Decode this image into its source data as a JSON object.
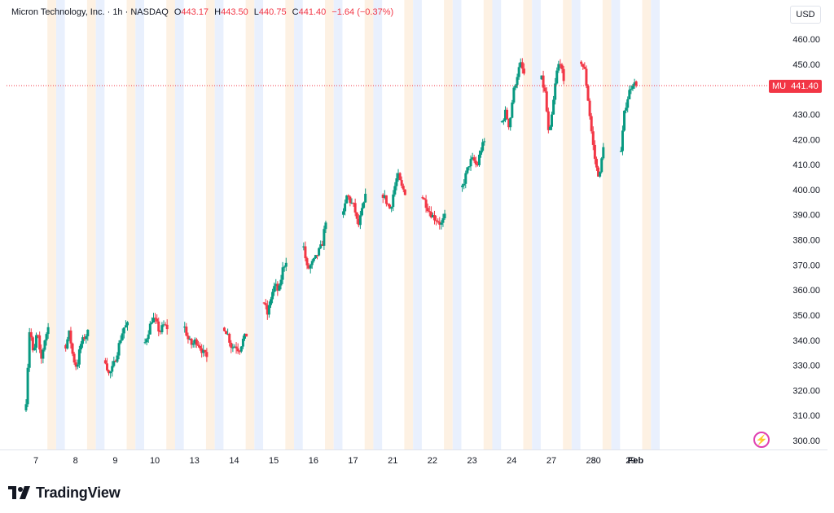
{
  "legend": {
    "symbol": "Micron Technology, Inc. · 1h · NASDAQ",
    "open_key": "O",
    "open": "443.17",
    "high_key": "H",
    "high": "443.50",
    "low_key": "L",
    "low": "440.75",
    "close_key": "C",
    "close": "441.40",
    "change": "−1.64 (−0.37%)"
  },
  "currency": "USD",
  "last_price": {
    "symbol": "MU",
    "value": "441.40",
    "price": 441.4
  },
  "branding": {
    "name": "TradingView"
  },
  "colors": {
    "up": "#089981",
    "down": "#f23645",
    "day_band_a": "#e9f0fd",
    "day_band_b": "#fdf1e3",
    "text": "#131722"
  },
  "icons": {
    "logo": "tradingview-logo-icon",
    "lightning": "lightning-icon"
  },
  "chart_data": {
    "type": "candlestick",
    "interval": "1h",
    "y_axis": {
      "ticks": [
        300,
        310,
        320,
        330,
        340,
        350,
        360,
        370,
        380,
        390,
        400,
        410,
        420,
        430,
        440,
        450,
        460
      ],
      "ylim": [
        297,
        462
      ],
      "position": "right"
    },
    "x_axis": {
      "labels": [
        "7",
        "8",
        "9",
        "10",
        "13",
        "14",
        "15",
        "16",
        "17",
        "21",
        "22",
        "23",
        "24",
        "27",
        "28",
        "29",
        "30",
        "Feb"
      ]
    },
    "session_anchors": [
      [
        316,
        346,
        333,
        344,
        331,
        340,
        345
      ],
      [
        338,
        343,
        333,
        329,
        338,
        341,
        343
      ],
      [
        332,
        326,
        329,
        334,
        340,
        345,
        346
      ],
      [
        339,
        344,
        349,
        347,
        343,
        346,
        345
      ],
      [
        345,
        340,
        338,
        340,
        338,
        335,
        333
      ],
      [
        345,
        342,
        337,
        338,
        336,
        340,
        342
      ],
      [
        355,
        350,
        358,
        362,
        359,
        368,
        372
      ],
      [
        377,
        368,
        370,
        372,
        375,
        378,
        388
      ],
      [
        390,
        398,
        395,
        393,
        385,
        391,
        397
      ],
      [
        398,
        395,
        392,
        400,
        406,
        401,
        399
      ],
      [
        397,
        394,
        391,
        389,
        388,
        386,
        389
      ],
      [
        401,
        406,
        411,
        412,
        409,
        416,
        419
      ],
      [
        427,
        431,
        425,
        438,
        445,
        450,
        446
      ],
      [
        444,
        438,
        420,
        432,
        446,
        452,
        442
      ],
      [
        451,
        447,
        434,
        420,
        409,
        405,
        418
      ],
      [
        415,
        432,
        438,
        443,
        441
      ]
    ],
    "last_close": 441.4
  }
}
